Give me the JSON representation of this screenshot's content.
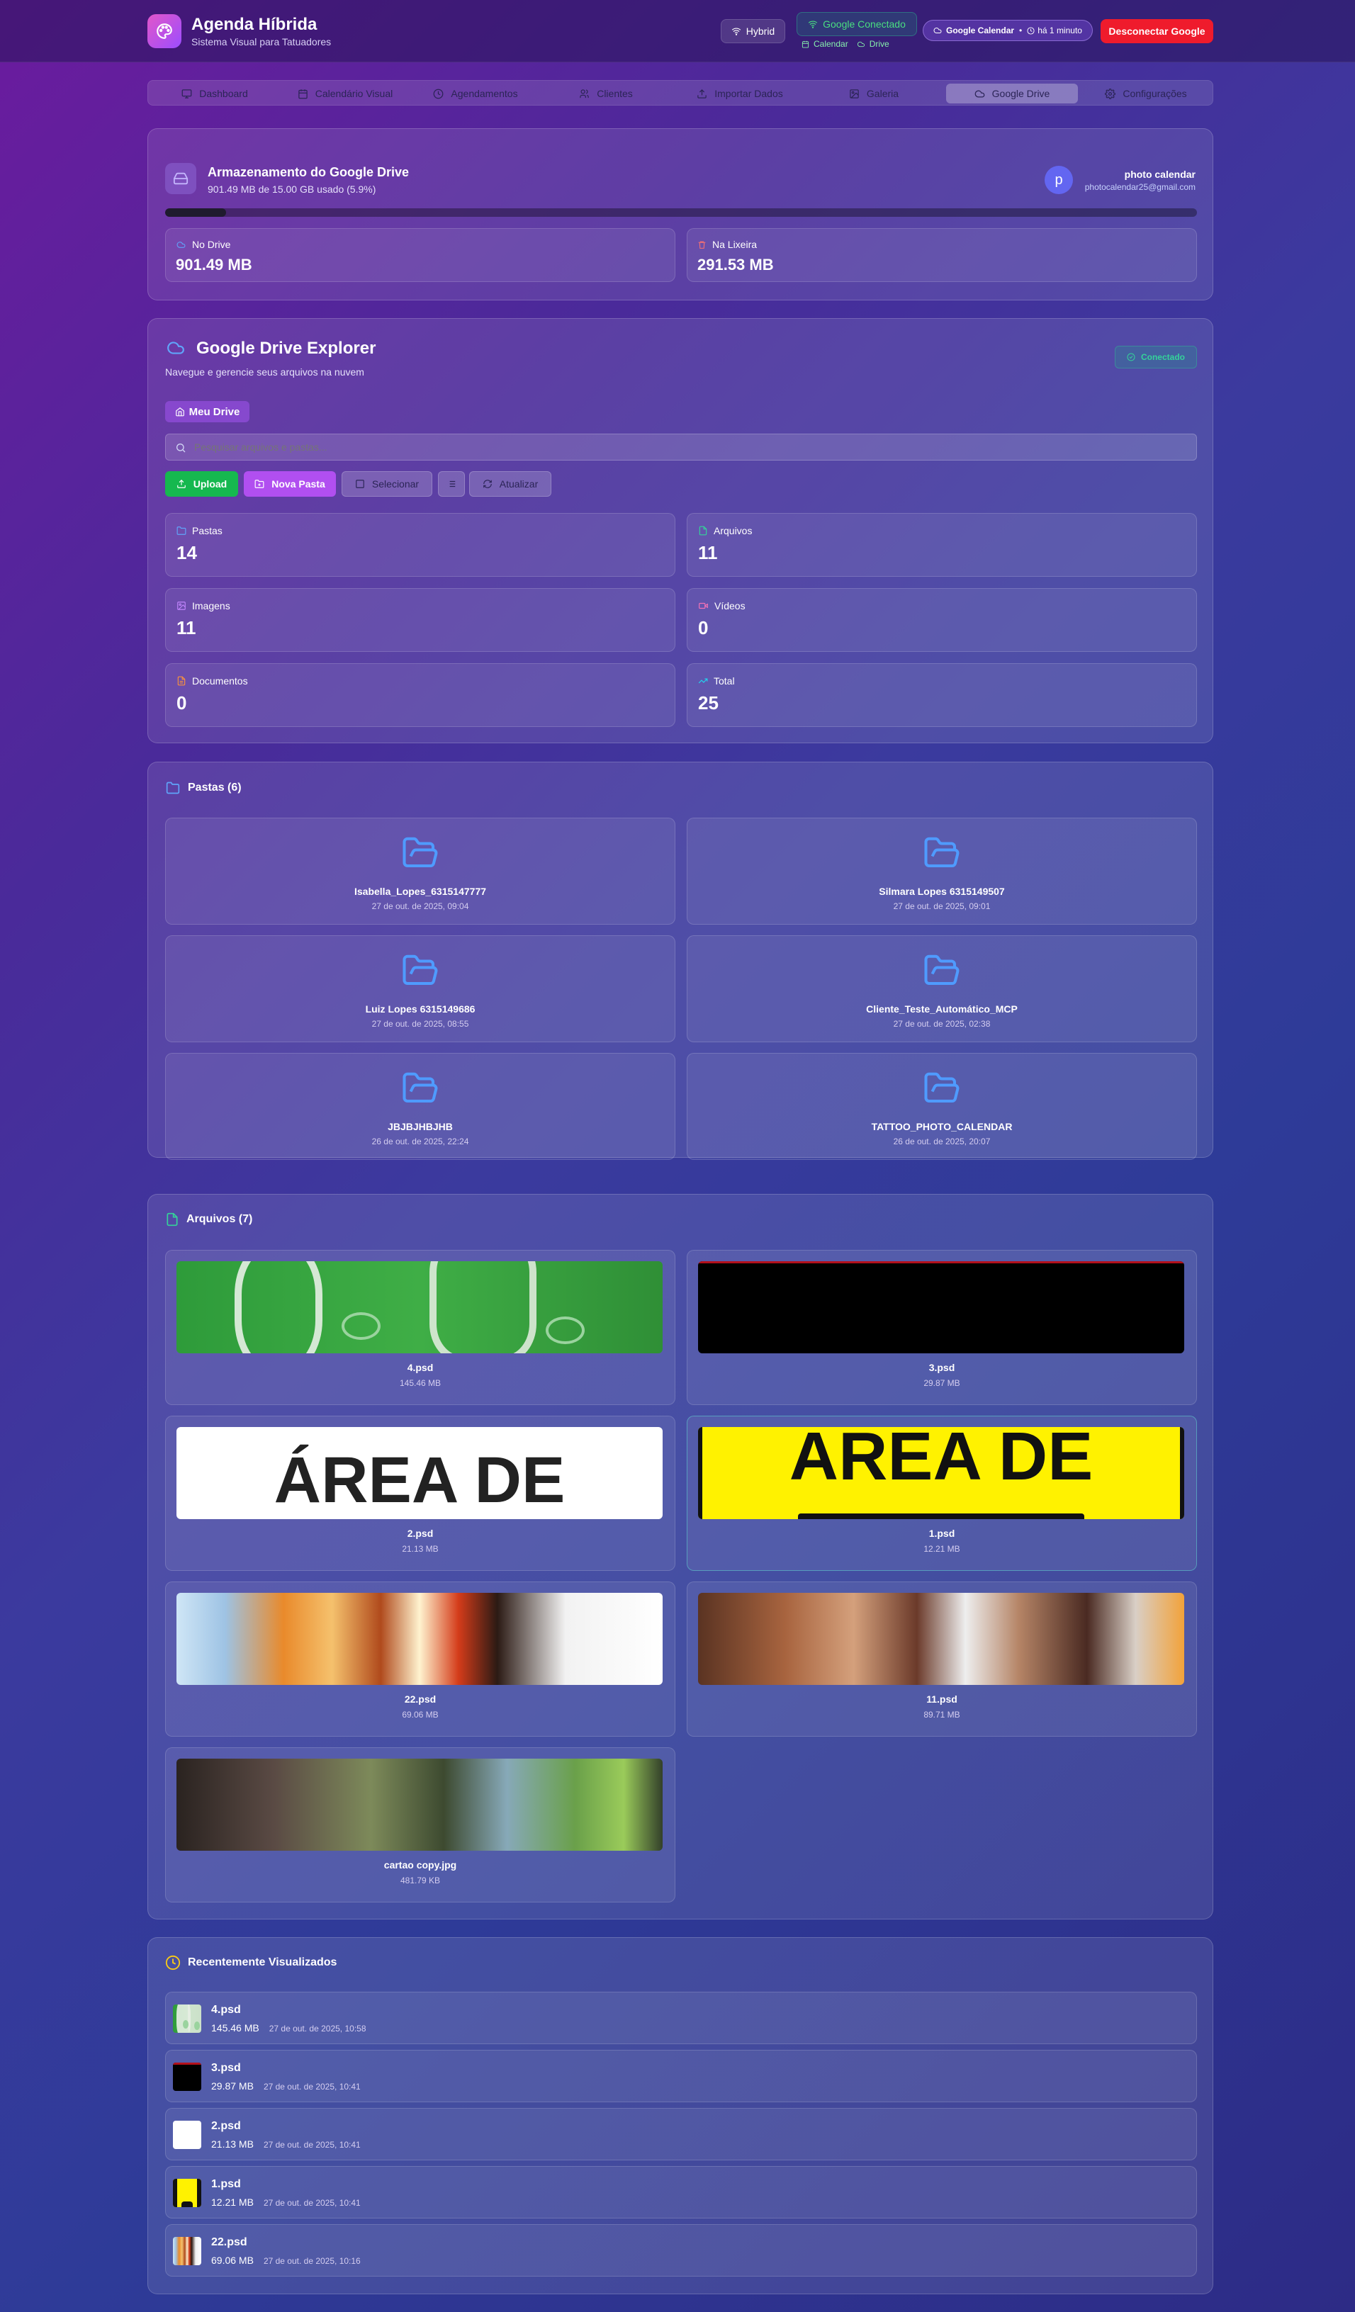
{
  "header": {
    "title": "Agenda Híbrida",
    "subtitle": "Sistema Visual para Tatuadores",
    "hybrid_label": "Hybrid",
    "google_connected": "Google Conectado",
    "sub_calendar": "Calendar",
    "sub_drive": "Drive",
    "gcal_label": "Google Calendar",
    "gcal_time": "há 1 minuto",
    "disconnect_label": "Desconectar Google"
  },
  "tabs": [
    {
      "label": "Dashboard",
      "icon": "monitor-icon"
    },
    {
      "label": "Calendário Visual",
      "icon": "calendar-icon"
    },
    {
      "label": "Agendamentos",
      "icon": "clock-icon"
    },
    {
      "label": "Clientes",
      "icon": "users-icon"
    },
    {
      "label": "Importar Dados",
      "icon": "upload-icon"
    },
    {
      "label": "Galeria",
      "icon": "image-icon"
    },
    {
      "label": "Google Drive",
      "icon": "cloud-icon",
      "active": true
    },
    {
      "label": "Configurações",
      "icon": "gear-icon"
    }
  ],
  "storage": {
    "title": "Armazenamento do Google Drive",
    "usage": "901.49 MB de 15.00 GB usado (5.9%)",
    "percent": 5.9,
    "user_initial": "p",
    "user_name": "photo calendar",
    "user_email": "photocalendar25@gmail.com",
    "drive_label": "No Drive",
    "drive_value": "901.49 MB",
    "trash_label": "Na Lixeira",
    "trash_value": "291.53 MB"
  },
  "explorer": {
    "title": "Google Drive Explorer",
    "subtitle": "Navegue e gerencie seus arquivos na nuvem",
    "status": "Conectado",
    "breadcrumb": "Meu Drive",
    "search_placeholder": "Pesquisar arquivos e pastas...",
    "upload_label": "Upload",
    "new_folder_label": "Nova Pasta",
    "select_label": "Selecionar",
    "refresh_label": "Atualizar",
    "stats": [
      {
        "label": "Pastas",
        "value": "14",
        "icon": "folder-icon",
        "color": "#60a5fa"
      },
      {
        "label": "Arquivos",
        "value": "11",
        "icon": "file-icon",
        "color": "#34d399"
      },
      {
        "label": "Imagens",
        "value": "11",
        "icon": "image-icon",
        "color": "#c084fc"
      },
      {
        "label": "Vídeos",
        "value": "0",
        "icon": "video-icon",
        "color": "#f472b6"
      },
      {
        "label": "Documentos",
        "value": "0",
        "icon": "document-icon",
        "color": "#fb923c"
      },
      {
        "label": "Total",
        "value": "25",
        "icon": "trend-icon",
        "color": "#22d3ee"
      }
    ]
  },
  "folders": {
    "title": "Pastas (6)",
    "items": [
      {
        "name": "Isabella_Lopes_6315147777",
        "date": "27 de out. de 2025, 09:04"
      },
      {
        "name": "Silmara Lopes 6315149507",
        "date": "27 de out. de 2025, 09:01"
      },
      {
        "name": "Luiz Lopes 6315149686",
        "date": "27 de out. de 2025, 08:55"
      },
      {
        "name": "Cliente_Teste_Automático_MCP",
        "date": "27 de out. de 2025, 02:38"
      },
      {
        "name": "JBJBJHBJHB",
        "date": "26 de out. de 2025, 22:24"
      },
      {
        "name": "TATTOO_PHOTO_CALENDAR",
        "date": "26 de out. de 2025, 20:07"
      }
    ]
  },
  "files": {
    "title": "Arquivos (7)",
    "items": [
      {
        "name": "4.psd",
        "size": "145.46 MB",
        "thumb": "test-green"
      },
      {
        "name": "3.psd",
        "size": "29.87 MB",
        "thumb": "black"
      },
      {
        "name": "2.psd",
        "size": "21.13 MB",
        "thumb": "area-white",
        "thumb_text": "ÁREA DE"
      },
      {
        "name": "1.psd",
        "size": "12.21 MB",
        "thumb": "area-yellow",
        "thumb_text": "AREA DE"
      },
      {
        "name": "22.psd",
        "size": "69.06 MB",
        "thumb": "anime-1"
      },
      {
        "name": "11.psd",
        "size": "89.71 MB",
        "thumb": "anime-2"
      },
      {
        "name": "cartao copy.jpg",
        "size": "481.79 KB",
        "thumb": "photo"
      }
    ]
  },
  "recent": {
    "title": "Recentemente Visualizados",
    "items": [
      {
        "name": "4.psd",
        "size": "145.46 MB",
        "date": "27 de out. de 2025, 10:58",
        "thumb": "test-green"
      },
      {
        "name": "3.psd",
        "size": "29.87 MB",
        "date": "27 de out. de 2025, 10:41",
        "thumb": "black"
      },
      {
        "name": "2.psd",
        "size": "21.13 MB",
        "date": "27 de out. de 2025, 10:41",
        "thumb": "area-white"
      },
      {
        "name": "1.psd",
        "size": "12.21 MB",
        "date": "27 de out. de 2025, 10:41",
        "thumb": "area-yellow"
      },
      {
        "name": "22.psd",
        "size": "69.06 MB",
        "date": "27 de out. de 2025, 10:16",
        "thumb": "anime-1"
      }
    ]
  }
}
